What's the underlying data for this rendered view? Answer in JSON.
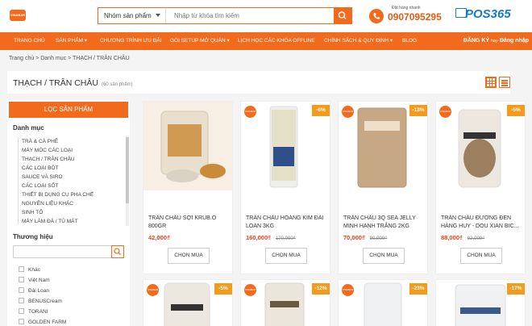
{
  "header": {
    "logo_text": "VINABAR",
    "search_category": "Nhóm sản phẩm",
    "search_placeholder": "Nhập từ khóa tìm kiếm",
    "hotline_label": "Đặt hàng nhanh",
    "hotline": "0907095295",
    "brand_logo": "POS365",
    "brand_color": "#f26b1d"
  },
  "nav": {
    "items": [
      "TRANG CHỦ",
      "SẢN PHẨM ▾",
      "CHƯƠNG TRÌNH ƯU ĐÃI",
      "GÓI SETUP MỞ QUÁN ▾",
      "LỊCH HỌC CÁC KHÓA OFFLINE",
      "CHÍNH SÁCH & QUY ĐỊNH ▾",
      "BLOG"
    ],
    "register": "ĐĂNG KÝ",
    "or": "hay",
    "login": "Đăng nhập"
  },
  "breadcrumb": "Trang chủ  >  Danh mục  >  THẠCH / TRÂN CHÂU",
  "page": {
    "title": "THẠCH / TRÂN CHÂU",
    "count": "(60 sản phẩm)"
  },
  "sidebar": {
    "filter_title": "LỌC SẢN PHẨM",
    "category_heading": "Danh mục",
    "categories": [
      "TRÀ & CÀ PHÊ",
      "MÁY MÓC CÁC LOẠI",
      "THẠCH / TRÂN CHÂU",
      "CÁC LOẠI BỘT",
      "SAUCE VÀ SIRO",
      "CÁC LOẠI SỐT",
      "THIẾT BỊ DỤNG CỤ PHA CHẾ",
      "NGUYÊN LIỆU KHÁC",
      "SINH TỐ",
      "MÁY LÀM ĐÁ / TỦ MÁT"
    ],
    "brand_heading": "Thương hiệu",
    "brands": [
      "Khác",
      "Việt Nam",
      "Đài Loan",
      "BENUSCream",
      "TORANI",
      "GOLDEN FARM"
    ]
  },
  "products": [
    {
      "name": "TRÂN CHÂU SỢI KRUB.O 800GR",
      "price": "42,000₫",
      "old_price": "",
      "discount": "",
      "brand_badge": false,
      "img": "krubo"
    },
    {
      "name": "TRÂN CHÂU HOÀNG KIM ĐÀI LOAN 3KG",
      "price": "160,000₫",
      "old_price": "170,000₫",
      "discount": "-6%",
      "brand_badge": true,
      "img": "goldbag"
    },
    {
      "name": "TRÂN CHÂU 3Q SEA JELLY MINH HẠNH TRẮNG 2KG",
      "price": "70,000₫",
      "old_price": "80,000₫",
      "discount": "-13%",
      "brand_badge": true,
      "img": "brownbag"
    },
    {
      "name": "TRÂN CHÂU ĐƯỜNG ĐEN HÀNG HUY - DOU XIAN BIC...",
      "price": "88,000₫",
      "old_price": "92,000₫",
      "discount": "-5%",
      "brand_badge": true,
      "img": "douxian"
    },
    {
      "name": "",
      "price": "",
      "old_price": "",
      "discount": "-5%",
      "brand_badge": true,
      "img": "douxian2"
    },
    {
      "name": "",
      "price": "",
      "old_price": "",
      "discount": "-12%",
      "brand_badge": true,
      "img": "clear"
    },
    {
      "name": "",
      "price": "",
      "old_price": "",
      "discount": "-23%",
      "brand_badge": true,
      "img": "clear2"
    },
    {
      "name": "",
      "price": "",
      "old_price": "",
      "discount": "-17%",
      "brand_badge": true,
      "img": "vinos"
    }
  ],
  "buy_label": "CHỌN MUA"
}
